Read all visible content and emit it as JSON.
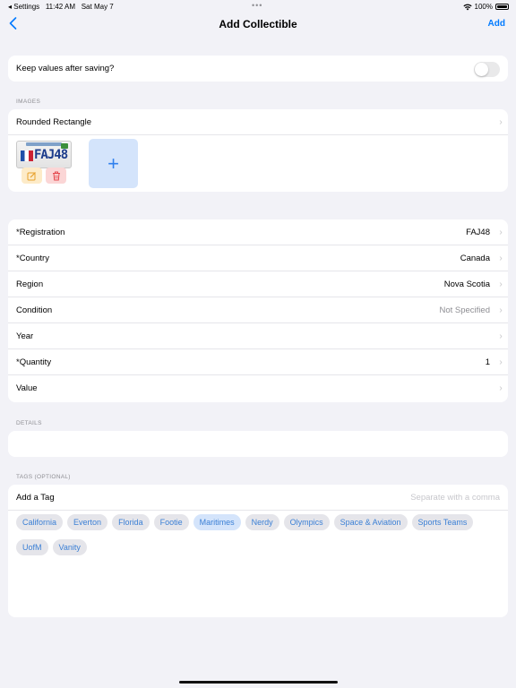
{
  "status_bar": {
    "back_app": "◂ Settings",
    "time": "11:42 AM",
    "date": "Sat May 7",
    "dots": "•••",
    "battery": "100%"
  },
  "nav": {
    "back_icon": "chevron-left-icon",
    "title": "Add Collectible",
    "add_label": "Add"
  },
  "keep_values": {
    "label": "Keep values after saving?",
    "toggle_on": false
  },
  "images": {
    "section_label": "IMAGES",
    "shape_label": "Rounded Rectangle",
    "plate_reg": "FAJ48",
    "add_symbol": "+"
  },
  "fields": [
    {
      "label": "*Registration",
      "value": "FAJ48",
      "muted": false
    },
    {
      "label": "*Country",
      "value": "Canada",
      "muted": false
    },
    {
      "label": "Region",
      "value": "Nova Scotia",
      "muted": false
    },
    {
      "label": "Condition",
      "value": "Not Specified",
      "muted": true
    },
    {
      "label": "Year",
      "value": "",
      "muted": false
    },
    {
      "label": "*Quantity",
      "value": "1",
      "muted": false
    },
    {
      "label": "Value",
      "value": "",
      "muted": false
    }
  ],
  "details": {
    "section_label": "DETAILS",
    "value": ""
  },
  "tags": {
    "section_label": "TAGS (OPTIONAL)",
    "add_label": "Add a Tag",
    "placeholder": "Separate with a comma",
    "items": [
      {
        "label": "California",
        "selected": false
      },
      {
        "label": "Everton",
        "selected": false
      },
      {
        "label": "Florida",
        "selected": false
      },
      {
        "label": "Footie",
        "selected": false
      },
      {
        "label": "Maritimes",
        "selected": true
      },
      {
        "label": "Nerdy",
        "selected": false
      },
      {
        "label": "Olympics",
        "selected": false
      },
      {
        "label": "Space & Aviation",
        "selected": false
      },
      {
        "label": "Sports Teams",
        "selected": false
      },
      {
        "label": "UofM",
        "selected": false
      },
      {
        "label": "Vanity",
        "selected": false
      }
    ]
  },
  "colors": {
    "accent": "#007aff",
    "background": "#f2f2f7",
    "chip_text": "#3a7fd5"
  }
}
